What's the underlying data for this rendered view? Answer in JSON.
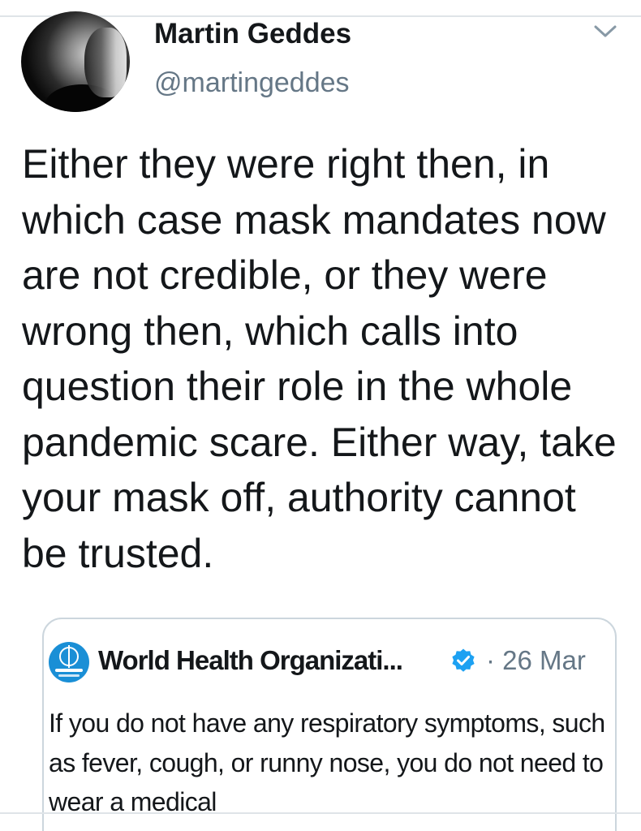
{
  "author": {
    "display_name": "Martin Geddes",
    "handle": "@martingeddes",
    "avatar_icon": "author-avatar"
  },
  "menu": {
    "icon": "chevron-down-icon",
    "color": "#8899a6"
  },
  "tweet": {
    "text": "Either they were right then, in which case mask mandates now are not credible, or they were wrong then, which calls into question their role in the whole pandemic scare. Either way, take your mask off, authority cannot be trusted."
  },
  "quoted_tweet": {
    "author_name": "World Health Organizati...",
    "verified": true,
    "verified_icon": "verified-badge-icon",
    "verified_color": "#1da1f2",
    "date": "· 26 Mar",
    "logo_icon": "who-logo",
    "logo_color": "#1a8fd6",
    "text": "If you do not have any respiratory symptoms, such as fever, cough, or runny nose, you do not need to wear a medical"
  },
  "colors": {
    "text_primary": "#14171a",
    "text_secondary": "#657786",
    "border": "#ccd6dd"
  }
}
